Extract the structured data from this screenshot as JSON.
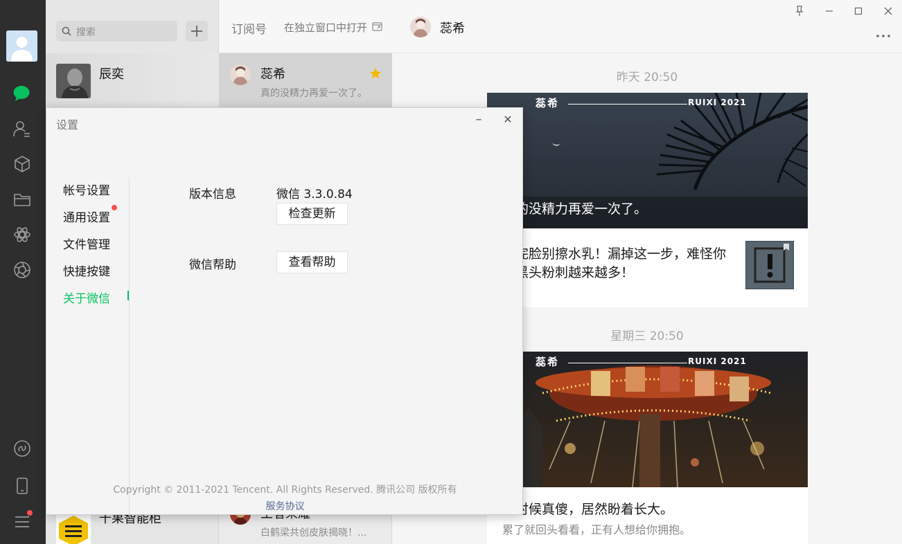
{
  "search": {
    "placeholder": "搜索"
  },
  "chats": [
    {
      "name": "辰奕"
    },
    {
      "name": "千果智能柜"
    }
  ],
  "subscriptions": {
    "title": "订阅号",
    "open_in_window": "在独立窗口中打开",
    "items": [
      {
        "name": "蕊希",
        "desc": "真的没精力再爱一次了。",
        "starred": true
      },
      {
        "name": "王者荣耀",
        "desc": "白鹤梁共创皮肤揭晓！..."
      }
    ]
  },
  "conversation": {
    "title": "蕊希",
    "messages": [
      {
        "time": "昨天 20:50",
        "cover_brand": "蕊希",
        "cover_brand_en": "RUIXI 2021",
        "cover_caption": "真的没精力再爱一次了。",
        "sub_article": "洗完脸别擦水乳！漏掉这一步，难怪你的黑头粉刺越来越多！"
      },
      {
        "time": "星期三 20:50",
        "cover_brand": "蕊希",
        "cover_brand_en": "RUIXI 2021",
        "title": "小时候真傻，居然盼着长大。",
        "desc": "累了就回头看看，正有人想给你拥抱。"
      }
    ]
  },
  "settings": {
    "title": "设置",
    "menu": [
      "帐号设置",
      "通用设置",
      "文件管理",
      "快捷按键",
      "关于微信"
    ],
    "active_index": 4,
    "version_label": "版本信息",
    "version_value": "微信 3.3.0.84",
    "check_update": "检查更新",
    "help_label": "微信帮助",
    "view_help": "查看帮助",
    "copyright": "Copyright © 2011-2021 Tencent. All Rights Reserved. 腾讯公司 版权所有",
    "agreement": "服务协议"
  },
  "colors": {
    "accent": "#07c160",
    "nav_bg": "#2e2e2e",
    "badge": "#fa5151",
    "star": "#f5b800",
    "link": "#576b95"
  },
  "icons": [
    "chat-icon",
    "contacts-icon",
    "cube-icon",
    "folder-icon",
    "moments-icon",
    "shutter-icon",
    "miniprogram-icon",
    "phone-icon",
    "menu-icon",
    "pin-icon",
    "minimize-icon",
    "maximize-icon",
    "close-icon",
    "more-icon",
    "star-icon",
    "search-icon",
    "plus-icon"
  ]
}
